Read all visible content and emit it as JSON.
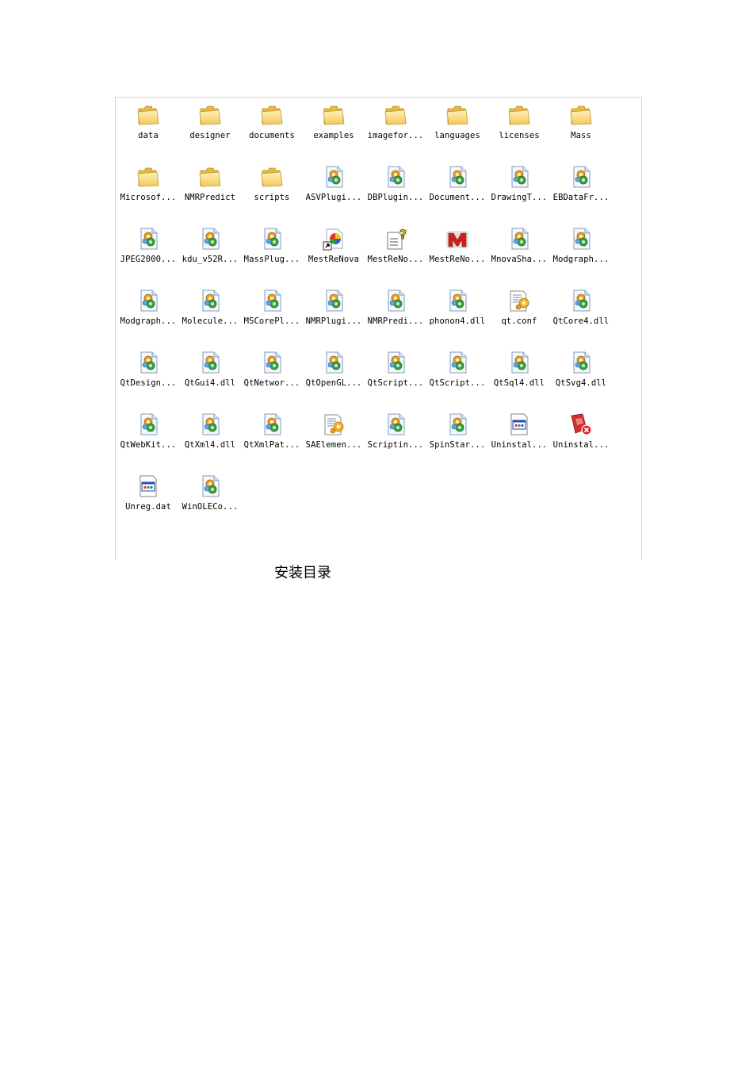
{
  "caption": "安装目录",
  "files": [
    {
      "label": "data",
      "icon": "folder-icon"
    },
    {
      "label": "designer",
      "icon": "folder-icon"
    },
    {
      "label": "documents",
      "icon": "folder-icon"
    },
    {
      "label": "examples",
      "icon": "folder-icon"
    },
    {
      "label": "imagefor...",
      "icon": "folder-icon"
    },
    {
      "label": "languages",
      "icon": "folder-icon"
    },
    {
      "label": "licenses",
      "icon": "folder-icon"
    },
    {
      "label": "Mass",
      "icon": "folder-icon"
    },
    {
      "label": "Microsof...",
      "icon": "folder-icon"
    },
    {
      "label": "NMRPredict",
      "icon": "folder-icon"
    },
    {
      "label": "scripts",
      "icon": "folder-icon"
    },
    {
      "label": "ASVPlugi...",
      "icon": "dll-icon"
    },
    {
      "label": "DBPlugin...",
      "icon": "dll-icon"
    },
    {
      "label": "Document...",
      "icon": "dll-icon"
    },
    {
      "label": "DrawingT...",
      "icon": "dll-icon"
    },
    {
      "label": "EBDataFr...",
      "icon": "dll-icon"
    },
    {
      "label": "JPEG2000...",
      "icon": "dll-icon"
    },
    {
      "label": "kdu_v52R...",
      "icon": "dll-icon"
    },
    {
      "label": "MassPlug...",
      "icon": "dll-icon"
    },
    {
      "label": "MestReNova",
      "icon": "shortcut-icon"
    },
    {
      "label": "MestReNo...",
      "icon": "help-file-icon"
    },
    {
      "label": "MestReNo...",
      "icon": "mestrenova-app-icon"
    },
    {
      "label": "MnovaSha...",
      "icon": "dll-icon"
    },
    {
      "label": "Modgraph...",
      "icon": "dll-icon"
    },
    {
      "label": "Modgraph...",
      "icon": "dll-icon"
    },
    {
      "label": "Molecule...",
      "icon": "dll-icon"
    },
    {
      "label": "MSCorePl...",
      "icon": "dll-icon"
    },
    {
      "label": "NMRPlugi...",
      "icon": "dll-icon"
    },
    {
      "label": "NMRPredi...",
      "icon": "dll-icon"
    },
    {
      "label": "phonon4.dll",
      "icon": "dll-icon"
    },
    {
      "label": "qt.conf",
      "icon": "config-file-icon"
    },
    {
      "label": "QtCore4.dll",
      "icon": "dll-icon"
    },
    {
      "label": "QtDesign...",
      "icon": "dll-icon"
    },
    {
      "label": "QtGui4.dll",
      "icon": "dll-icon"
    },
    {
      "label": "QtNetwor...",
      "icon": "dll-icon"
    },
    {
      "label": "QtOpenGL...",
      "icon": "dll-icon"
    },
    {
      "label": "QtScript...",
      "icon": "dll-icon"
    },
    {
      "label": "QtScript...",
      "icon": "dll-icon"
    },
    {
      "label": "QtSql4.dll",
      "icon": "dll-icon"
    },
    {
      "label": "QtSvg4.dll",
      "icon": "dll-icon"
    },
    {
      "label": "QtWebKit...",
      "icon": "dll-icon"
    },
    {
      "label": "QtXml4.dll",
      "icon": "dll-icon"
    },
    {
      "label": "QtXmlPat...",
      "icon": "dll-icon"
    },
    {
      "label": "SAElemen...",
      "icon": "config-file-icon"
    },
    {
      "label": "Scriptin...",
      "icon": "dll-icon"
    },
    {
      "label": "SpinStar...",
      "icon": "dll-icon"
    },
    {
      "label": "Uninstal...",
      "icon": "dat-file-icon"
    },
    {
      "label": "Uninstal...",
      "icon": "uninstaller-icon"
    },
    {
      "label": "Unreg.dat",
      "icon": "dat-file-icon"
    },
    {
      "label": "WinOLECo...",
      "icon": "dll-icon"
    }
  ]
}
